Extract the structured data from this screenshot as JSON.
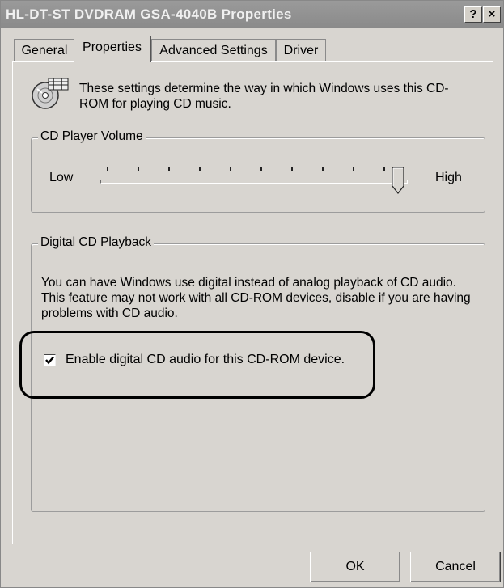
{
  "window": {
    "title": "HL-DT-ST DVDRAM GSA-4040B Properties"
  },
  "title_buttons": {
    "help": "?",
    "close": "×"
  },
  "tabs": [
    {
      "label": "General",
      "active": false
    },
    {
      "label": "Properties",
      "active": true
    },
    {
      "label": "Advanced Settings",
      "active": false
    },
    {
      "label": "Driver",
      "active": false
    }
  ],
  "info": {
    "icon": "cd-music-icon",
    "text": "These settings determine the way in which Windows uses this CD-ROM for playing CD music."
  },
  "volume": {
    "legend": "CD Player Volume",
    "low_label": "Low",
    "high_label": "High",
    "level": 1.0
  },
  "digital": {
    "legend": "Digital CD Playback",
    "description": "You can have Windows use digital instead of analog playback of CD audio.  This feature may not work with all CD-ROM devices, disable if you are having problems with CD audio.",
    "checkbox_label": "Enable digital CD audio for this CD-ROM device.",
    "checked": true
  },
  "buttons": {
    "ok": "OK",
    "cancel": "Cancel"
  }
}
